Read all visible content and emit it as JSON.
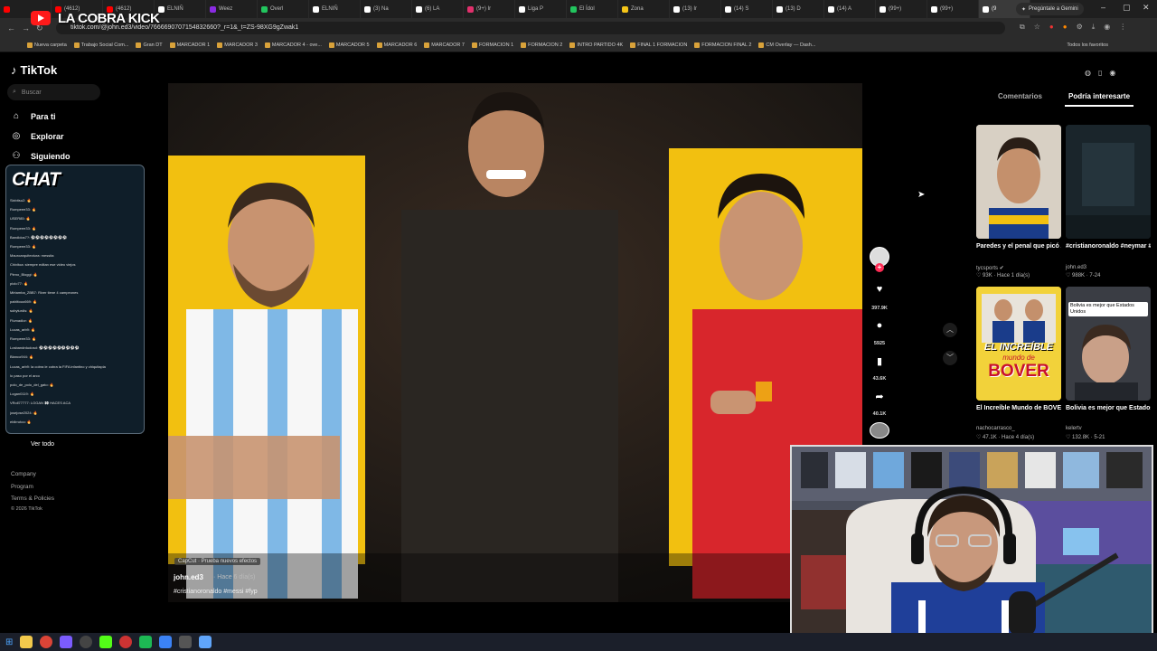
{
  "browser": {
    "tabs": [
      {
        "label": "",
        "color": "#ff0000"
      },
      {
        "label": "(4612)",
        "color": "#ff0000"
      },
      {
        "label": "(4612)",
        "color": "#ff0000"
      },
      {
        "label": "ELNIÑ",
        "color": "#ffffff"
      },
      {
        "label": "Weez",
        "color": "#8a2be2"
      },
      {
        "label": "Overl",
        "color": "#22c55e"
      },
      {
        "label": "ELNIÑ",
        "color": "#ffffff"
      },
      {
        "label": "(3) Na",
        "color": "#ffffff"
      },
      {
        "label": "(6) LA",
        "color": "#ffffff"
      },
      {
        "label": "(9+) Ir",
        "color": "#e1306c"
      },
      {
        "label": "Liga P",
        "color": "#ffffff"
      },
      {
        "label": "El Ídol",
        "color": "#22c55e"
      },
      {
        "label": "Zona",
        "color": "#f5c518"
      },
      {
        "label": "(13) Ir",
        "color": "#ffffff"
      },
      {
        "label": "(14) S",
        "color": "#ffffff"
      },
      {
        "label": "(13) D",
        "color": "#ffffff"
      },
      {
        "label": "(14) A",
        "color": "#ffffff"
      },
      {
        "label": "(99+)",
        "color": "#ffffff"
      },
      {
        "label": "(99+)",
        "color": "#ffffff"
      },
      {
        "label": "(9",
        "color": "#ffffff"
      }
    ],
    "gemini_label": "Pregúntale a Gemini",
    "url": "tiktok.com/@john.ed3/video/7666690707154832660?_r=1&_t=ZS-98XG9gZwak1",
    "bookmarks": [
      "Nueva carpeta",
      "Trabajo Social Com...",
      "Gran DT",
      "MARCADOR 1",
      "MARCADOR 3",
      "MARCADOR 4 - ove...",
      "MARCADOR 5",
      "MARCADOR 6",
      "MARCADOR 7",
      "FORMACION 1",
      "FORMACION 2",
      "INTRO PARTIDO 4K",
      "FINAL 1 FORMACION",
      "FORMACION FINAL 2",
      "CM Overlay — Dash..."
    ],
    "all_favorites": "Todos los favoritos"
  },
  "stream": {
    "title": "LA COBRA KICK"
  },
  "sidebar": {
    "logo": "TikTok",
    "search_placeholder": "Buscar",
    "items": [
      {
        "label": "Para ti",
        "icon": "home-icon"
      },
      {
        "label": "Explorar",
        "icon": "compass-icon"
      },
      {
        "label": "Siguiendo",
        "icon": "following-icon"
      }
    ],
    "see_all": "Ver todo",
    "footer": [
      "Company",
      "Program",
      "Terms & Policies",
      "© 2026 TikTok"
    ]
  },
  "chat": {
    "title": "CHAT",
    "lines": [
      "Sixbitsu2: 🔥",
      "Rompeee33: 🔥",
      "USER85: 🔥",
      "Rompeee33: 🔥",
      "Bandidos7?: ⚽⚽⚽⚽⚽⚽⚽⚽",
      "Rompeee33: 🔥",
      "Mauroarquitectura: messita",
      "Chivitoa: siempre editan ese video viejos",
      "Pleno_Bloggi: 🔥",
      "piolo77: 🔥",
      "Mirtamba_ZBB7: River tiene 4 campeones",
      "pablitouo669: 🔥",
      "sobyturdis: 🔥",
      "Flumadlor: 🔥",
      "Lucas_arb9: 🔥",
      "Rompeee33: 🔥",
      "Losbandrdudosd: ⚽⚽⚽⚽⚽⚽⚽⚽⚽",
      "Blanco944: 🔥",
      "Lucas_arb9: la cobra le cobra la FIFA infantino y chiquitapia",
      "lo paso por el arco",
      "polo_de_polo_del_gato: 🔥",
      "Logan0119: 🔥",
      "VRoll77777: LOGAN 👀 HACES ACA",
      "josejose2024: 🔥",
      "ebilrrotoo: 🔥"
    ]
  },
  "video": {
    "capcut_badge": "CapCut · Prueba nuevos efectos",
    "author": "john.ed3",
    "time": "· Hace 6 día(s)",
    "hashtags": "#cristianoronaldo #messi #fyp",
    "counts": {
      "likes": "397.9K",
      "comments": "5925",
      "saves": "43.6K",
      "shares": "40.1K"
    }
  },
  "right_panel": {
    "tabs": [
      "Comentarios",
      "Podría interesarte"
    ],
    "active_tab": "Podría interesarte",
    "videos": [
      {
        "title": "Paredes y el penal que picó Aranda: \"SO...",
        "author": "tycsports ✔",
        "stats": "♡ 93K · Hace 1 día(s)"
      },
      {
        "title": "#cristianoronaldo #neymar #messi...",
        "author": "john.ed3",
        "stats": "♡ 988K · 7-24"
      },
      {
        "title": "El Increíble Mundo de BOVER #boca #river...",
        "author": "nachocarrasco_",
        "stats": "♡ 47.1K · Hace 4 día(s)"
      },
      {
        "title": "Bolivia es mejor que Estados Unidos #kele...",
        "author": "kelertv",
        "stats": "♡ 132.8K · 5-21"
      }
    ],
    "thumb_overlays": {
      "bover_line1": "EL INCREÍBLE",
      "bover_line2": "mundo de",
      "bover_line3": "BOVER",
      "bolivia_caption": "Bolivia es mejor que Estados Unidos"
    }
  }
}
